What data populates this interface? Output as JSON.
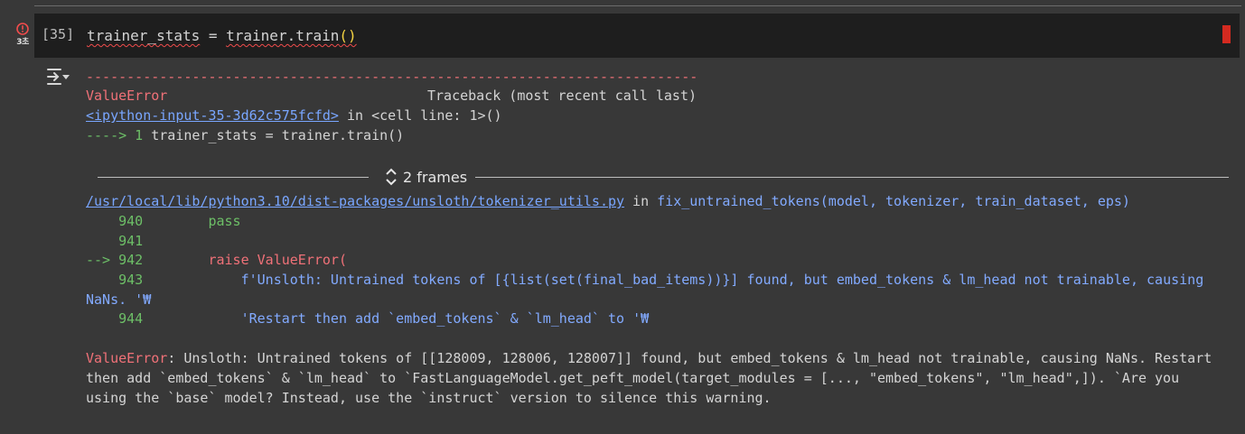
{
  "cell": {
    "execution_count": "[35]",
    "status_time": "3초",
    "code": {
      "var": "trainer_stats",
      "eq": " = ",
      "call": "trainer.train",
      "parens": "()"
    }
  },
  "colors": {
    "error_red": "#f07178",
    "line_green": "#6dbf67",
    "accent_blue": "#82aaff",
    "link_blue": "#79a6ff",
    "marker_red": "#d42a20"
  },
  "traceback": {
    "dashes": "---------------------------------------------------------------------------",
    "error_name": "ValueError",
    "header_right": "Traceback (most recent call last)",
    "input_link": "<ipython-input-35-3d62c575fcfd>",
    "input_in": " in <cell line: 1>()",
    "arrow_prefix": "----> 1 ",
    "arrow_code": "trainer_stats = trainer.train()",
    "frames_label": "2 frames",
    "file_link": "/usr/local/lib/python3.10/dist-packages/unsloth/tokenizer_utils.py",
    "file_in": " in ",
    "func_name": "fix_untrained_tokens",
    "func_args": "(model, tokenizer, train_dataset, eps)",
    "lines": [
      {
        "num": "    940 ",
        "code": "       pass"
      },
      {
        "num": "    941 ",
        "code": ""
      },
      {
        "num": "--> 942 ",
        "code": "       raise ValueError("
      },
      {
        "num": "    943 ",
        "code": "           f'Unsloth: Untrained tokens of [{list(set(final_bad_items))}] found, but embed_tokens & lm_head not trainable, causing"
      },
      {
        "num": "",
        "code": "NaNs. '₩"
      },
      {
        "num": "    944 ",
        "code": "           'Restart then add `embed_tokens` & `lm_head` to '₩"
      }
    ],
    "final_error_name": "ValueError",
    "final_message": ": Unsloth: Untrained tokens of [[128009, 128006, 128007]] found, but embed_tokens & lm_head not trainable, causing NaNs. Restart then add `embed_tokens` & `lm_head` to `FastLanguageModel.get_peft_model(target_modules = [..., \"embed_tokens\", \"lm_head\",]). `Are you using the `base` model? Instead, use the `instruct` version to silence this warning."
  }
}
